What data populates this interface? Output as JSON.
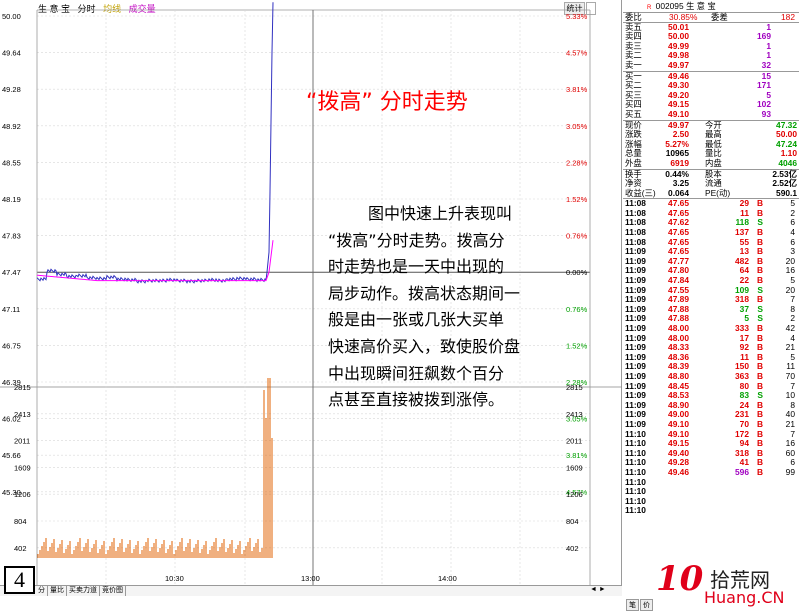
{
  "top_bar": {
    "name": "生 意 宝",
    "label_fenshi": "分时",
    "label_avg": "均线",
    "label_vol": "成交量",
    "stat": "统计"
  },
  "left_axis": [
    "50.00",
    "49.64",
    "49.28",
    "48.92",
    "48.55",
    "48.19",
    "47.83",
    "47.47",
    "47.11",
    "46.75",
    "46.39",
    "46.02",
    "45.66",
    "45.30"
  ],
  "right_axis": [
    "5.33%",
    "4.57%",
    "3.81%",
    "3.05%",
    "2.28%",
    "1.52%",
    "0.76%",
    "0.00%",
    "0.76%",
    "1.52%",
    "2.28%",
    "3.05%",
    "3.81%",
    "4.57%"
  ],
  "vol_axis": [
    "2815",
    "2413",
    "2011",
    "1609",
    "1206",
    "804",
    "402"
  ],
  "time_axis": [
    "10:30",
    "13:00",
    "14:00"
  ],
  "title_text": "“拨高” 分时走势",
  "description_lines": [
    "图中快速上升表现叫",
    "“拨高”分时走势。拨高分",
    "时走势也是一天中出现的",
    "局步动作。拨高状态期间一",
    "般是由一张或几张大买单",
    "快速高价买入，致使股价盘",
    "中出现瞬间狂飙数个百分",
    "点甚至直接被拨到涨停。"
  ],
  "page_number": "4",
  "bottom_tabs": [
    "分",
    "量比",
    "买卖力道",
    "竞价图"
  ],
  "nav_arrows": "◄ ►",
  "quote": {
    "code": "002095",
    "name": "生 意 宝",
    "r_mark": "R",
    "weibi_label": "委比",
    "weibi": "30.85%",
    "weicha_label": "委差",
    "weicha": "182",
    "sell": [
      {
        "label": "卖五",
        "price": "50.01",
        "vol": "1"
      },
      {
        "label": "卖四",
        "price": "50.00",
        "vol": "169"
      },
      {
        "label": "卖三",
        "price": "49.99",
        "vol": "1"
      },
      {
        "label": "卖二",
        "price": "49.98",
        "vol": "1"
      },
      {
        "label": "卖一",
        "price": "49.97",
        "vol": "32"
      }
    ],
    "buy": [
      {
        "label": "买一",
        "price": "49.46",
        "vol": "15"
      },
      {
        "label": "买二",
        "price": "49.30",
        "vol": "171"
      },
      {
        "label": "买三",
        "price": "49.20",
        "vol": "5"
      },
      {
        "label": "买四",
        "price": "49.15",
        "vol": "102"
      },
      {
        "label": "买五",
        "price": "49.10",
        "vol": "93"
      }
    ],
    "stats": [
      {
        "l1": "现价",
        "v1": "49.97",
        "l2": "今开",
        "v2": "47.32",
        "c1": "red",
        "c2": "green"
      },
      {
        "l1": "涨跌",
        "v1": "2.50",
        "l2": "最高",
        "v2": "50.00",
        "c1": "red",
        "c2": "red"
      },
      {
        "l1": "涨幅",
        "v1": "5.27%",
        "l2": "最低",
        "v2": "47.24",
        "c1": "red",
        "c2": "green"
      },
      {
        "l1": "总量",
        "v1": "10965",
        "l2": "量比",
        "v2": "1.10",
        "c1": "",
        "c2": "red"
      },
      {
        "l1": "外盘",
        "v1": "6919",
        "l2": "内盘",
        "v2": "4046",
        "c1": "red",
        "c2": "green"
      }
    ],
    "stats2": [
      {
        "l1": "换手",
        "v1": "0.44%",
        "l2": "股本",
        "v2": "2.53亿"
      },
      {
        "l1": "净资",
        "v1": "3.25",
        "l2": "流通",
        "v2": "2.52亿"
      },
      {
        "l1": "收益(三)",
        "v1": "0.064",
        "l2": "PE(动)",
        "v2": "590.1"
      }
    ],
    "ticks": [
      {
        "t": "11:08",
        "p": "47.65",
        "v": "29",
        "s": "B",
        "n": "5"
      },
      {
        "t": "11:08",
        "p": "47.65",
        "v": "11",
        "s": "B",
        "n": "2"
      },
      {
        "t": "11:08",
        "p": "47.62",
        "v": "118",
        "s": "S",
        "n": "6"
      },
      {
        "t": "11:08",
        "p": "47.65",
        "v": "137",
        "s": "B",
        "n": "4"
      },
      {
        "t": "11:08",
        "p": "47.65",
        "v": "55",
        "s": "B",
        "n": "6"
      },
      {
        "t": "11:09",
        "p": "47.65",
        "v": "13",
        "s": "B",
        "n": "3"
      },
      {
        "t": "11:09",
        "p": "47.77",
        "v": "482",
        "s": "B",
        "n": "20"
      },
      {
        "t": "11:09",
        "p": "47.80",
        "v": "64",
        "s": "B",
        "n": "16"
      },
      {
        "t": "11:09",
        "p": "47.84",
        "v": "22",
        "s": "B",
        "n": "5"
      },
      {
        "t": "11:09",
        "p": "47.55",
        "v": "109",
        "s": "S",
        "n": "20"
      },
      {
        "t": "11:09",
        "p": "47.89",
        "v": "318",
        "s": "B",
        "n": "7"
      },
      {
        "t": "11:09",
        "p": "47.88",
        "v": "37",
        "s": "S",
        "n": "8"
      },
      {
        "t": "11:09",
        "p": "47.88",
        "v": "5",
        "s": "S",
        "n": "2"
      },
      {
        "t": "11:09",
        "p": "48.00",
        "v": "333",
        "s": "B",
        "n": "42"
      },
      {
        "t": "11:09",
        "p": "48.00",
        "v": "17",
        "s": "B",
        "n": "4"
      },
      {
        "t": "11:09",
        "p": "48.33",
        "v": "92",
        "s": "B",
        "n": "21"
      },
      {
        "t": "11:09",
        "p": "48.36",
        "v": "11",
        "s": "B",
        "n": "5"
      },
      {
        "t": "11:09",
        "p": "48.39",
        "v": "150",
        "s": "B",
        "n": "11"
      },
      {
        "t": "11:09",
        "p": "48.80",
        "v": "363",
        "s": "B",
        "n": "70"
      },
      {
        "t": "11:09",
        "p": "48.45",
        "v": "80",
        "s": "B",
        "n": "7"
      },
      {
        "t": "11:09",
        "p": "48.53",
        "v": "83",
        "s": "S",
        "n": "10"
      },
      {
        "t": "11:09",
        "p": "48.90",
        "v": "24",
        "s": "B",
        "n": "8"
      },
      {
        "t": "11:09",
        "p": "49.00",
        "v": "231",
        "s": "B",
        "n": "40"
      },
      {
        "t": "11:09",
        "p": "49.10",
        "v": "70",
        "s": "B",
        "n": "21"
      },
      {
        "t": "11:10",
        "p": "49.10",
        "v": "172",
        "s": "B",
        "n": "7"
      },
      {
        "t": "11:10",
        "p": "49.15",
        "v": "94",
        "s": "B",
        "n": "16"
      },
      {
        "t": "11:10",
        "p": "49.40",
        "v": "318",
        "s": "B",
        "n": "60"
      },
      {
        "t": "11:10",
        "p": "49.28",
        "v": "41",
        "s": "B",
        "n": "6"
      },
      {
        "t": "11:10",
        "p": "49.46",
        "v": "596",
        "s": "B",
        "n": "99"
      },
      {
        "t": "11:10",
        "p": "",
        "v": "",
        "s": "",
        "n": ""
      },
      {
        "t": "11:10",
        "p": "",
        "v": "",
        "s": "",
        "n": ""
      },
      {
        "t": "11:10",
        "p": "",
        "v": "",
        "s": "",
        "n": ""
      },
      {
        "t": "11:10",
        "p": "",
        "v": "",
        "s": "",
        "n": ""
      }
    ]
  },
  "side_tabs": [
    "笔",
    "价"
  ],
  "watermark": {
    "logo_text": "10",
    "name_cn": "拾荒网",
    "name_en": "Huang.CN"
  },
  "colors": {
    "price_line": "#3030c0",
    "avg_line": "#ff00ff",
    "volume_bar": "#e06000",
    "up": "#e00000",
    "down": "#00a000"
  }
}
